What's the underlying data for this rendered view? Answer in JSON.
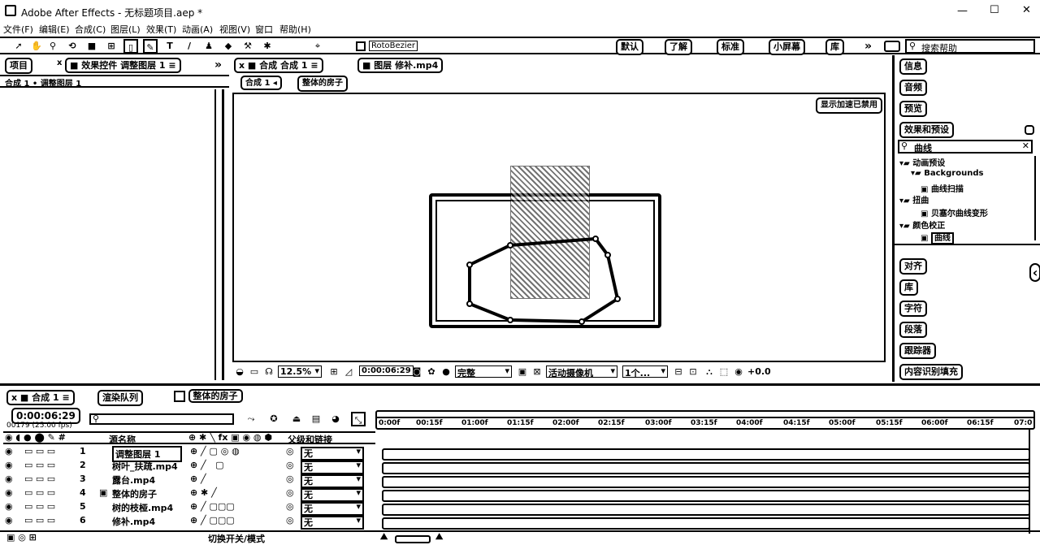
{
  "app": {
    "title": "Adobe After Effects - 无标题项目.aep *",
    "window_controls": {
      "minimize": "—",
      "maximize": "☐",
      "close": "✕"
    }
  },
  "menu": [
    "文件(F)",
    "编辑(E)",
    "合成(C)",
    "图层(L)",
    "效果(T)",
    "动画(A)",
    "视图(V)",
    "窗口",
    "帮助(H)"
  ],
  "toolbar": {
    "tools": [
      "selection",
      "hand",
      "zoom",
      "rotate",
      "camera",
      "pan-behind",
      "rectangle",
      "pen",
      "type",
      "brush",
      "clone-stamp",
      "eraser",
      "roto-brush",
      "puppet"
    ],
    "rotobezier_label": "RotoBezier",
    "workspaces": [
      "默认",
      "了解",
      "标准",
      "小屏幕"
    ],
    "workspace_more": "库",
    "search_help_placeholder": "搜索帮助"
  },
  "left_panel": {
    "tab_project": "项目",
    "tab_effects": "效果控件 调整图层 1",
    "breadcrumb": "合成 1 • 调整图层 1"
  },
  "viewer": {
    "tab_comp": "合成 合成 1",
    "tab_layer": "图层 修补.mp4",
    "sub_comp": "合成 1",
    "sub_layer": "整体的房子",
    "accel_badge": "显示加速已禁用",
    "zoom": "12.5%",
    "timecode": "0:00:06:29",
    "resolution": "完整",
    "camera": "活动摄像机",
    "views": "1个...",
    "exposure": "+0.0"
  },
  "right_panel": {
    "items_top": [
      "信息",
      "音频",
      "预览",
      "效果和预设"
    ],
    "search_value": "曲线",
    "tree": [
      {
        "level": 0,
        "label": "动画预设"
      },
      {
        "level": 1,
        "label": "Backgrounds"
      },
      {
        "level": 2,
        "label": "曲线扫描"
      },
      {
        "level": 0,
        "label": "扭曲"
      },
      {
        "level": 2,
        "label": "贝塞尔曲线变形"
      },
      {
        "level": 0,
        "label": "颜色校正"
      },
      {
        "level": 2,
        "label": "曲线"
      }
    ],
    "items_bottom": [
      "对齐",
      "库",
      "字符",
      "段落",
      "跟踪器",
      "内容识别填充"
    ]
  },
  "timeline": {
    "tab_active": "合成 1",
    "tab_render": "渲染队列",
    "tab_comp2": "整体的房子",
    "timecode": "0:00:06:29",
    "fps_info": "00179 (25.00 fps)",
    "search_placeholder": "",
    "col_name": "源名称",
    "col_parent": "父级和链接",
    "ruler": [
      "0:00f",
      "00:15f",
      "01:00f",
      "01:15f",
      "02:00f",
      "02:15f",
      "03:00f",
      "03:15f",
      "04:00f",
      "04:15f",
      "05:00f",
      "05:15f",
      "06:00f",
      "06:15f",
      "07:0"
    ],
    "layers": [
      {
        "num": "1",
        "name": "调整图层 1",
        "parent": "无"
      },
      {
        "num": "2",
        "name": "树叶_扶疏.mp4",
        "parent": "无"
      },
      {
        "num": "3",
        "name": "露台.mp4",
        "parent": "无"
      },
      {
        "num": "4",
        "name": "整体的房子",
        "parent": "无"
      },
      {
        "num": "5",
        "name": "树的枝桠.mp4",
        "parent": "无"
      },
      {
        "num": "6",
        "name": "修补.mp4",
        "parent": "无"
      }
    ],
    "footer_toggle": "切换开关/模式"
  }
}
